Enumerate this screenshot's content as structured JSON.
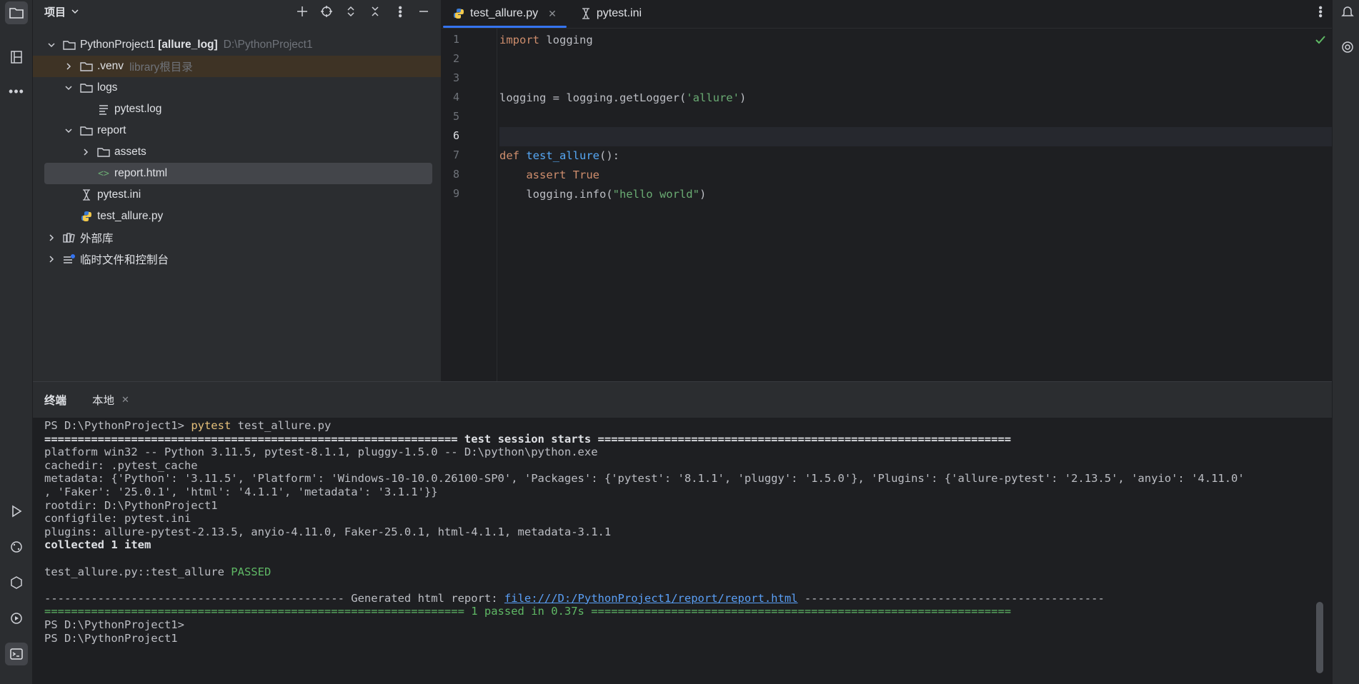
{
  "project_panel": {
    "title": "项目",
    "tree": [
      {
        "name": "PythonProject1",
        "bold": "[allure_log]",
        "path": "D:\\PythonProject1"
      },
      {
        "name": ".venv",
        "muted": "library根目录"
      },
      {
        "name": "logs"
      },
      {
        "name": "pytest.log"
      },
      {
        "name": "report"
      },
      {
        "name": "assets"
      },
      {
        "name": "report.html"
      },
      {
        "name": "pytest.ini"
      },
      {
        "name": "test_allure.py"
      },
      {
        "name": "外部库"
      },
      {
        "name": "临时文件和控制台"
      }
    ]
  },
  "editor": {
    "tabs": [
      {
        "label": "test_allure.py",
        "active": true
      },
      {
        "label": "pytest.ini",
        "active": false
      }
    ],
    "line_numbers": [
      "1",
      "2",
      "3",
      "4",
      "5",
      "6",
      "7",
      "8",
      "9"
    ],
    "lines": [
      [
        {
          "t": "import",
          "c": "kw"
        },
        {
          "t": " logging",
          "c": ""
        }
      ],
      [],
      [],
      [
        {
          "t": "logging = logging.getLogger(",
          "c": ""
        },
        {
          "t": "'allure'",
          "c": "str"
        },
        {
          "t": ")",
          "c": ""
        }
      ],
      [],
      [],
      [
        {
          "t": "def ",
          "c": "kw"
        },
        {
          "t": "test_allure",
          "c": "fn"
        },
        {
          "t": "():",
          "c": ""
        }
      ],
      [
        {
          "t": "    assert ",
          "c": "kw"
        },
        {
          "t": "True",
          "c": "kw"
        }
      ],
      [
        {
          "t": "    logging.info(",
          "c": ""
        },
        {
          "t": "\"hello world\"",
          "c": "str"
        },
        {
          "t": ")",
          "c": ""
        }
      ]
    ]
  },
  "terminal": {
    "tabs": [
      "终端",
      "本地"
    ],
    "lines": [
      [
        {
          "t": "PS D:\\PythonProject1> ",
          "c": ""
        },
        {
          "t": "pytest",
          "c": "yellow"
        },
        {
          "t": " test_allure.py",
          "c": ""
        }
      ],
      [
        {
          "t": "============================================================== ",
          "c": "boldw"
        },
        {
          "t": "test session starts",
          "c": "boldw"
        },
        {
          "t": " ==============================================================",
          "c": "boldw"
        }
      ],
      [
        {
          "t": "platform win32 -- Python 3.11.5, pytest-8.1.1, pluggy-1.5.0 -- D:\\python\\python.exe",
          "c": ""
        }
      ],
      [
        {
          "t": "cachedir: .pytest_cache",
          "c": ""
        }
      ],
      [
        {
          "t": "metadata: {'Python': '3.11.5', 'Platform': 'Windows-10-10.0.26100-SP0', 'Packages': {'pytest': '8.1.1', 'pluggy': '1.5.0'}, 'Plugins': {'allure-pytest': '2.13.5', 'anyio': '4.11.0'",
          "c": ""
        }
      ],
      [
        {
          "t": ", 'Faker': '25.0.1', 'html': '4.1.1', 'metadata': '3.1.1'}}",
          "c": ""
        }
      ],
      [
        {
          "t": "rootdir: D:\\PythonProject1",
          "c": ""
        }
      ],
      [
        {
          "t": "configfile: pytest.ini",
          "c": ""
        }
      ],
      [
        {
          "t": "plugins: allure-pytest-2.13.5, anyio-4.11.0, Faker-25.0.1, html-4.1.1, metadata-3.1.1",
          "c": ""
        }
      ],
      [
        {
          "t": "collected 1 item",
          "c": "boldw"
        }
      ],
      [],
      [
        {
          "t": "test_allure.py::test_allure ",
          "c": ""
        },
        {
          "t": "PASSED",
          "c": "green"
        }
      ],
      [],
      [
        {
          "t": "--------------------------------------------- Generated html report: ",
          "c": ""
        },
        {
          "t": "file:///D:/PythonProject1/report/report.html",
          "c": "link"
        },
        {
          "t": " ---------------------------------------------",
          "c": ""
        }
      ],
      [
        {
          "t": "=============================================================== ",
          "c": "green"
        },
        {
          "t": "1 passed",
          "c": "green"
        },
        {
          "t": " in 0.37s ",
          "c": "green"
        },
        {
          "t": "===============================================================",
          "c": "green"
        }
      ],
      [
        {
          "t": "PS D:\\PythonProject1>",
          "c": ""
        }
      ],
      [
        {
          "t": "PS D:\\PythonProject1",
          "c": ""
        }
      ]
    ]
  },
  "colors": {
    "bg": "#1e1f22",
    "panel": "#2b2d30",
    "accent": "#3574f0",
    "keyword": "#cf8e6d",
    "string": "#6aab73",
    "function": "#56a8f5"
  }
}
